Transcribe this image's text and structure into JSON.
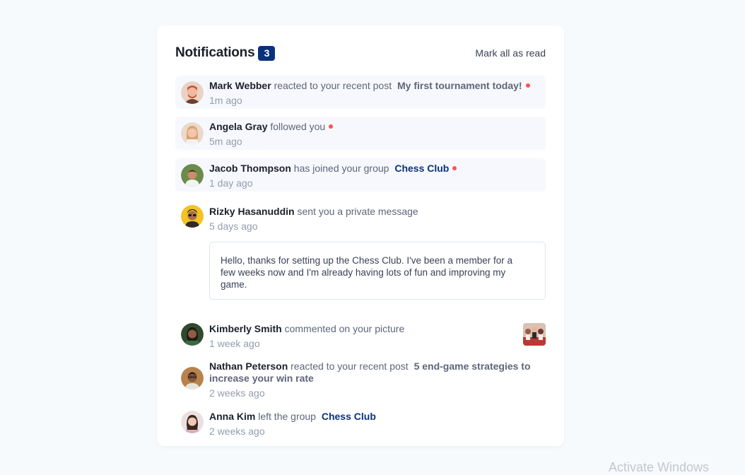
{
  "header": {
    "title": "Notifications",
    "unread_count": "3",
    "mark_all_label": "Mark all as read"
  },
  "notifications": [
    {
      "name": "Mark Webber",
      "action": "reacted to your recent post",
      "target": "My first tournament today!",
      "time": "1m ago",
      "unread": true
    },
    {
      "name": "Angela Gray",
      "action": "followed you",
      "time": "5m ago",
      "unread": true
    },
    {
      "name": "Jacob Thompson",
      "action": "has joined your group",
      "target": "Chess Club",
      "time": "1 day ago",
      "unread": true
    },
    {
      "name": "Rizky Hasanuddin",
      "action": "sent you a private message",
      "time": "5 days ago",
      "unread": false,
      "message": "Hello, thanks for setting up the Chess Club. I've been a member for a few weeks now and I'm already having lots of fun and improving my game."
    },
    {
      "name": "Kimberly Smith",
      "action": "commented on your picture",
      "time": "1 week ago",
      "unread": false
    },
    {
      "name": "Nathan Peterson",
      "action": "reacted to your recent post",
      "target": "5 end-game strategies to increase your win rate",
      "time": "2 weeks ago",
      "unread": false
    },
    {
      "name": "Anna Kim",
      "action": "left the group",
      "target": "Chess Club",
      "time": "2 weeks ago",
      "unread": false
    }
  ],
  "watermark": "Activate Windows",
  "colors": {
    "page_bg": "#f7fafd",
    "unread_bg": "#f6f8fd",
    "accent_blue": "#0a327b",
    "red_dot": "#f65552"
  }
}
